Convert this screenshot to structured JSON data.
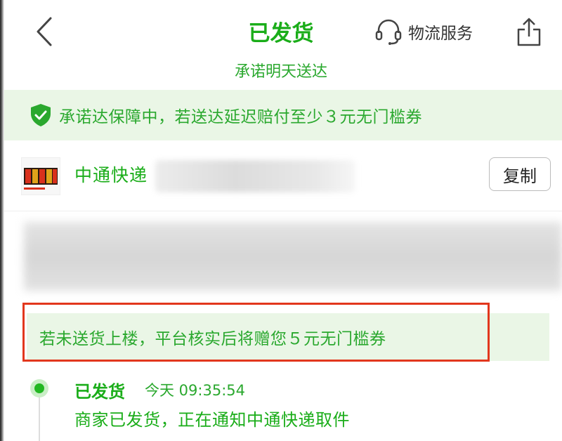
{
  "header": {
    "title": "已发货",
    "subtitle": "承诺明天送达",
    "service_label": "物流服务"
  },
  "guarantee_banner": {
    "text": "承诺达保障中，若送达延迟赔付至少３元无门槛券"
  },
  "package": {
    "carrier": "中通快递",
    "copy_label": "复制"
  },
  "notice": {
    "text": "若未送货上楼，平台核实后将赠您５元无门槛券"
  },
  "timeline": [
    {
      "status": "已发货",
      "time": "今天 09:35:54",
      "desc": "商家已发货，正在通知中通快递取件"
    }
  ],
  "colors": {
    "accent_green": "#1aad19",
    "banner_bg": "#eaf6e6",
    "highlight_red": "#e2371d"
  },
  "icons": [
    "back-icon",
    "headset-icon",
    "share-icon",
    "shield-check-icon"
  ]
}
